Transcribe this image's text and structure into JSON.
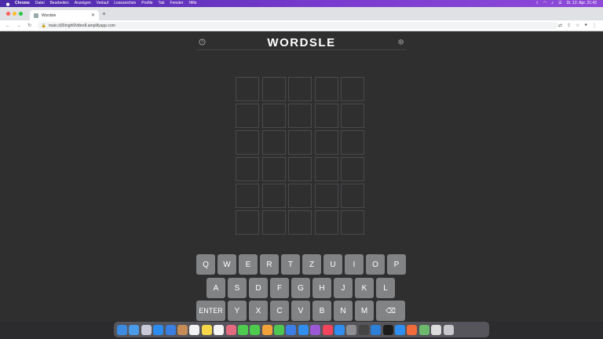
{
  "menubar": {
    "app": "Chrome",
    "items": [
      "Datei",
      "Bearbeiten",
      "Anzeigen",
      "Verlauf",
      "Lesezeichen",
      "Profile",
      "Tab",
      "Fenster",
      "Hilfe"
    ],
    "clock": "Di. 12. Apr.  21:42"
  },
  "browser": {
    "tab_title": "Wordsle",
    "url": "main.d30mgh6fvtbre8.amplifyapp.com"
  },
  "game": {
    "title": "WORDSLE",
    "rows": 6,
    "cols": 5
  },
  "keyboard": {
    "row1": [
      "Q",
      "W",
      "E",
      "R",
      "T",
      "Z",
      "U",
      "I",
      "O",
      "P"
    ],
    "row2": [
      "A",
      "S",
      "D",
      "F",
      "G",
      "H",
      "J",
      "K",
      "L"
    ],
    "row3": [
      "ENTER",
      "Y",
      "X",
      "C",
      "V",
      "B",
      "N",
      "M",
      "⌫"
    ]
  },
  "colors": {
    "background": "#2f2f30",
    "tile_border": "#4a4a4c",
    "key": "#818384",
    "menubar": "#6a34c4"
  },
  "dock": {
    "apps": [
      "finder-icon",
      "chrome-icon",
      "launchpad-icon",
      "safari-icon",
      "mail-icon",
      "contacts-icon",
      "calendar-icon",
      "notes-icon",
      "reminders-icon",
      "photos-icon",
      "messages-icon",
      "facetime-icon",
      "pages-icon",
      "numbers-icon",
      "keynote-icon",
      "app-store-icon",
      "podcasts-icon",
      "music-icon",
      "appstore-icon",
      "settings-icon",
      "disk-icon",
      "vscode-icon",
      "terminal-icon",
      "xcode-icon",
      "maps-icon",
      "android-studio-icon",
      "preview-icon",
      "trash-icon"
    ],
    "colors": [
      "#3d8be0",
      "#4a9be8",
      "#c9c9d9",
      "#2d8cf0",
      "#3a7fe0",
      "#c68c58",
      "#f2f2f2",
      "#f7d64a",
      "#f5f5f5",
      "#e26b7f",
      "#4ecb4f",
      "#4ecb4f",
      "#f1a33a",
      "#4fc552",
      "#3b7fe6",
      "#2f8ef0",
      "#9b59d6",
      "#f2445c",
      "#2f8ef0",
      "#8e8e93",
      "#444",
      "#2e7fd6",
      "#1d1d1d",
      "#2f8ef0",
      "#f26b3a",
      "#6cb96c",
      "#dcdcdc",
      "#c8c8cc"
    ]
  }
}
